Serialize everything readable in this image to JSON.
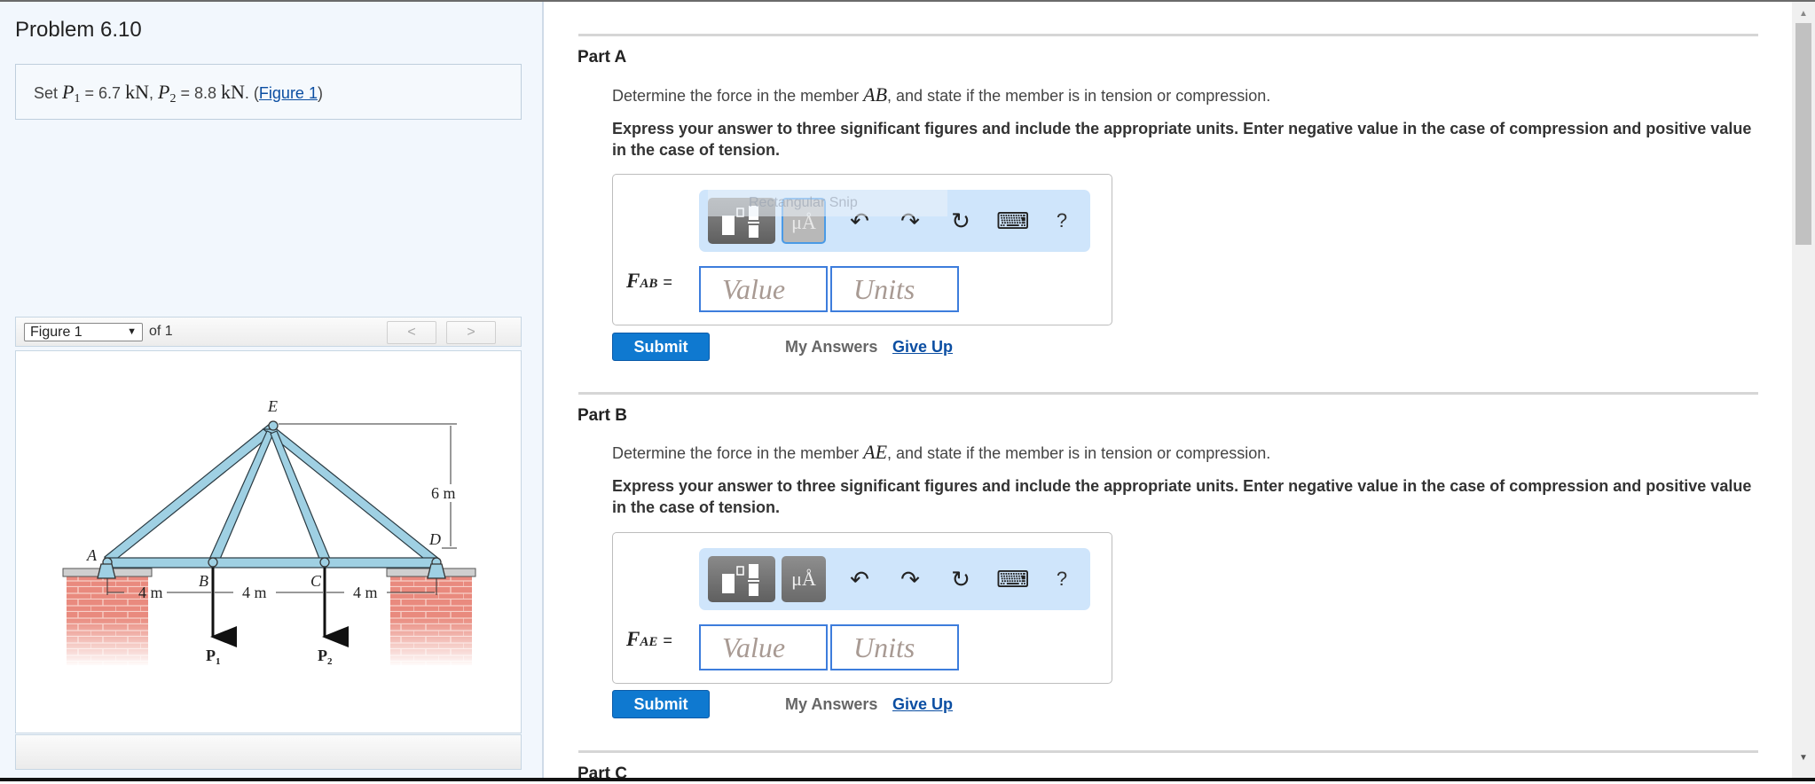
{
  "problem": {
    "title": "Problem 6.10",
    "statement": {
      "prefix": "Set",
      "p1_symbol": "P",
      "p1_sub": "1",
      "p1_eq": "= 6.7",
      "p1_unit": "kN",
      "sep": ",",
      "p2_symbol": "P",
      "p2_sub": "2",
      "p2_eq": "= 8.8",
      "p2_unit": "kN",
      "dot": ". (",
      "figure_link": "Figure 1",
      "close": ")"
    }
  },
  "figure_viewer": {
    "selected": "Figure 1",
    "of_label": "of 1",
    "prev_icon": "<",
    "next_icon": ">",
    "figure": {
      "joints": {
        "A": "A",
        "B": "B",
        "C": "C",
        "D": "D",
        "E": "E"
      },
      "dims": {
        "span1": "4 m",
        "span2": "4 m",
        "span3": "4 m",
        "height": "6 m"
      },
      "loads": {
        "p1": "P",
        "p1_sub": "1",
        "p2": "P",
        "p2_sub": "2"
      },
      "colors": {
        "member": "#9fd0e3",
        "brick": "#e7877b",
        "cap": "#c9c9c9"
      }
    }
  },
  "parts": [
    {
      "heading": "Part A",
      "question_pre": "Determine the force in the member",
      "member": "AB",
      "question_post": ", and state if the member is in tension or compression.",
      "instructions": "Express your answer to three significant figures and include the appropriate units. Enter negative value in the case of compression and positive value in the case of tension.",
      "toolbar": {
        "templates_icon": "templates-icon",
        "units_label": "μÅ",
        "undo_icon": "↶",
        "redo_icon": "↷",
        "reset_icon": "↻",
        "keyboard_icon": "⌨",
        "help_label": "?",
        "tooltip": "Rectangular Snip"
      },
      "label_main": "F",
      "label_sub": "AB",
      "label_eq": "=",
      "value_placeholder": "Value",
      "units_placeholder": "Units",
      "submit": "Submit",
      "my_answers": "My Answers",
      "give_up": "Give Up"
    },
    {
      "heading": "Part B",
      "question_pre": "Determine the force in the member",
      "member": "AE",
      "question_post": ", and state if the member is in tension or compression.",
      "instructions": "Express your answer to three significant figures and include the appropriate units. Enter negative value in the case of compression and positive value in the case of tension.",
      "toolbar": {
        "templates_icon": "templates-icon",
        "units_label": "μÅ",
        "undo_icon": "↶",
        "redo_icon": "↷",
        "reset_icon": "↻",
        "keyboard_icon": "⌨",
        "help_label": "?"
      },
      "label_main": "F",
      "label_sub": "AE",
      "label_eq": "=",
      "value_placeholder": "Value",
      "units_placeholder": "Units",
      "submit": "Submit",
      "my_answers": "My Answers",
      "give_up": "Give Up"
    },
    {
      "heading": "Part C"
    }
  ],
  "colors": {
    "accent": "#0f79d0",
    "link": "#0b4ea2",
    "toolbar_bg": "#cfe5fb",
    "input_border": "#3d7ddc",
    "left_panel_bg": "#f2f7fd"
  }
}
